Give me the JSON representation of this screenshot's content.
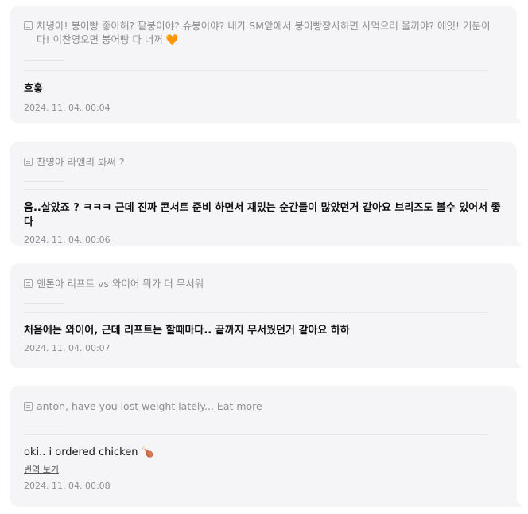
{
  "posts": [
    {
      "question": "차녕아! 붕어빵 좋아해? 팥붕이야? 슈붕이야? 내가 SM앞에서 붕어빵장사하면 사먹으러 올꺼야? 에잇! 기분이다! 이찬영오면 붕어빵 다 너꺼",
      "question_emoji": "🧡",
      "answer": "흐흫",
      "timestamp": "2024. 11. 04. 00:04"
    },
    {
      "question": "찬영아 라앤리 봐써 ?",
      "answer": "음..살았죠 ? ㅋㅋㅋ 근데 진짜 콘서트 준비 하면서 재밌는 순간들이 많았던거 같아요 브리즈도 볼수 있어서 좋다",
      "timestamp": "2024. 11. 04. 00:06"
    },
    {
      "question": "앤톤아 리프트 vs 와이어 뭐가 더 무서워",
      "answer": "처음에는 와이어, 근데 리프트는 할때마다.. 끝까지 무서웠던거 같아요 하하",
      "timestamp": "2024. 11. 04. 00:07"
    },
    {
      "question": "anton, have you lost weight lately... Eat more",
      "answer": "oki.. i ordered chicken",
      "answer_emoji": "🍗",
      "translate_link": "번역 보기",
      "timestamp": "2024. 11. 04. 00:08"
    }
  ],
  "colors": {
    "card_bg": "#f5f5f7",
    "question_text": "#8e8e93",
    "answer_text": "#111111",
    "heart": "#ff7a2f"
  },
  "icons": [
    "question-icon",
    "heart-emoji",
    "chicken-emoji"
  ]
}
